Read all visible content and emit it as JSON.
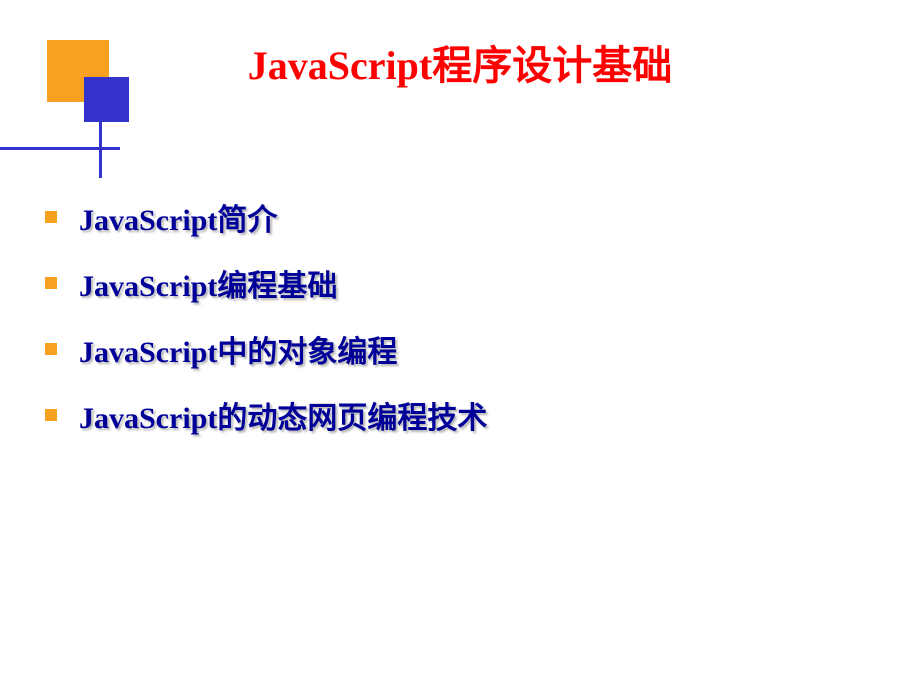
{
  "title": "JavaScript程序设计基础",
  "items": [
    "JavaScript简介",
    "JavaScript编程基础",
    "JavaScript中的对象编程",
    "JavaScript的动态网页编程技术"
  ]
}
